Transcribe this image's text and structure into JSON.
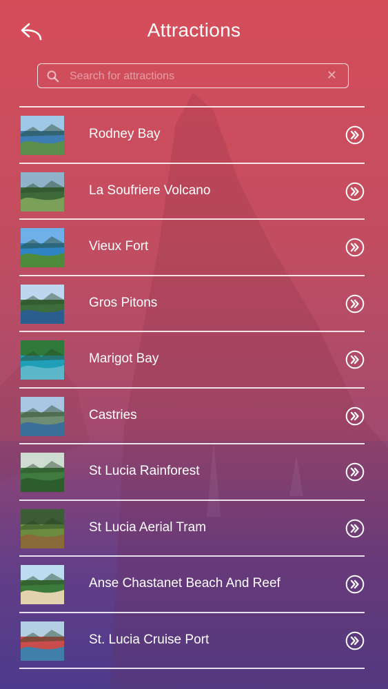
{
  "header": {
    "title": "Attractions",
    "back_icon": "back-arrow-icon"
  },
  "search": {
    "placeholder": "Search for attractions",
    "value": "",
    "search_icon": "search-icon",
    "clear_icon": "clear-icon"
  },
  "theme": {
    "gradient_top": "#d64d5a",
    "gradient_bottom": "#4f3c8c",
    "text": "#ffffff"
  },
  "attractions": [
    {
      "name": "Rodney Bay",
      "thumb": [
        "#9fc7e6",
        "#3d7db3",
        "#5b8f4b"
      ]
    },
    {
      "name": "La Soufriere Volcano",
      "thumb": [
        "#8fb2c9",
        "#3e6a3a",
        "#7aa05a"
      ]
    },
    {
      "name": "Vieux Fort",
      "thumb": [
        "#6fb0e8",
        "#2f84c4",
        "#4e8a3c"
      ]
    },
    {
      "name": "Gros Pitons",
      "thumb": [
        "#bfd7ee",
        "#3d6d3a",
        "#2c5d8f"
      ]
    },
    {
      "name": "Marigot Bay",
      "thumb": [
        "#2f7a3a",
        "#1fa0b8",
        "#5bb7c9"
      ]
    },
    {
      "name": "Castries",
      "thumb": [
        "#a9c7e2",
        "#6f8d74",
        "#3b6f9a"
      ]
    },
    {
      "name": "St Lucia Rainforest",
      "thumb": [
        "#cfdcd2",
        "#3f7a3f",
        "#2d5c2d"
      ]
    },
    {
      "name": "St Lucia Aerial Tram",
      "thumb": [
        "#3b5c34",
        "#6b8c3e",
        "#8a6a3a"
      ]
    },
    {
      "name": "Anse Chastanet Beach And Reef",
      "thumb": [
        "#bcdcf0",
        "#3b7a3a",
        "#e2d3ae"
      ]
    },
    {
      "name": "St. Lucia Cruise Port",
      "thumb": [
        "#b4cfe4",
        "#c94d4d",
        "#3f7fa8"
      ]
    }
  ],
  "row_icon": "chevron-circle-right-icon"
}
